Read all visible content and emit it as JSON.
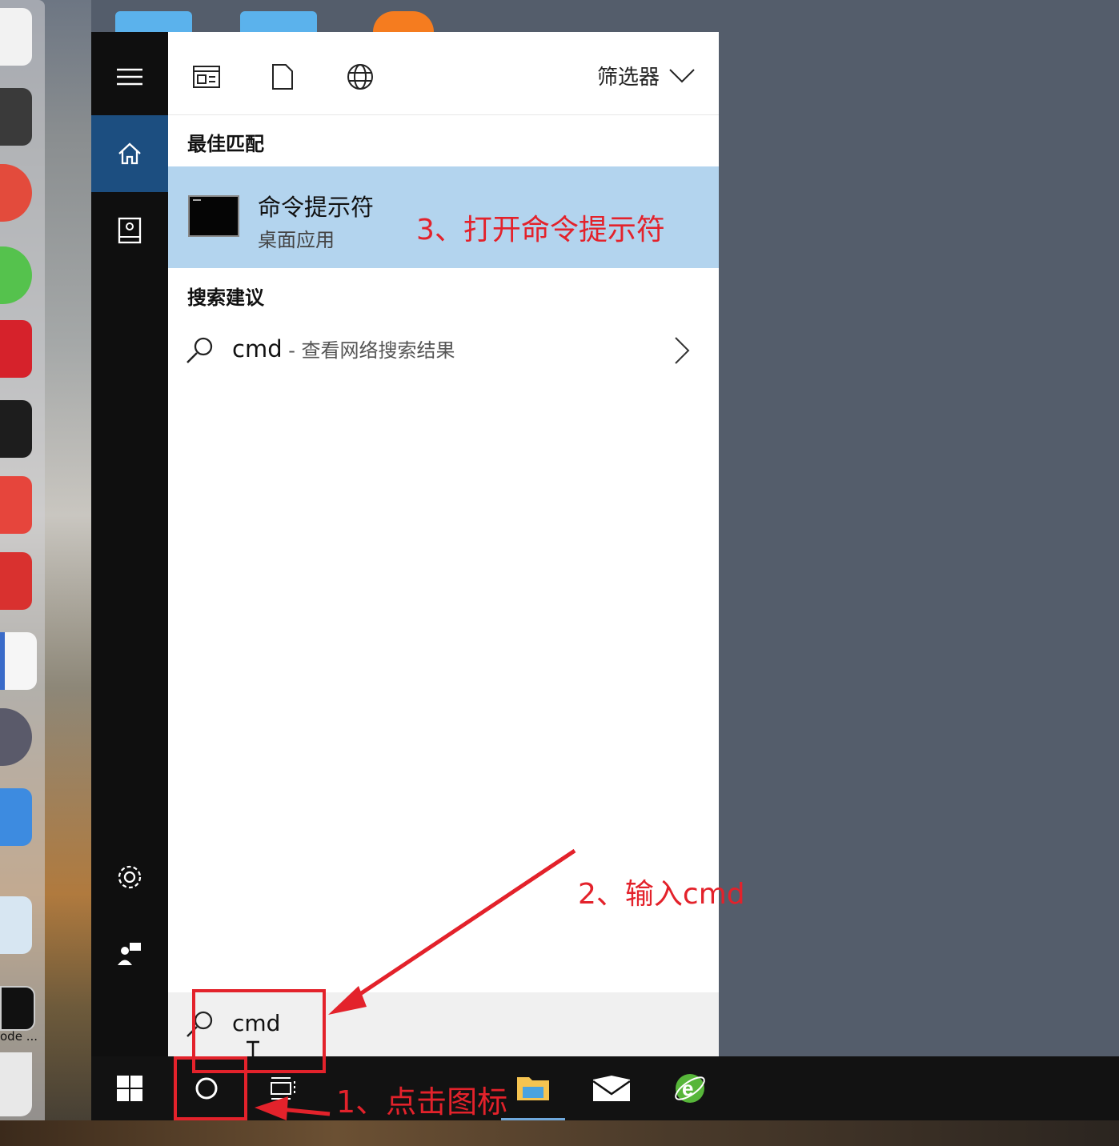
{
  "rail": {
    "items": [
      "menu-icon",
      "home-icon",
      "document-library-icon",
      "settings-icon",
      "user-feedback-icon"
    ]
  },
  "topbar": {
    "icons": [
      "app-window-icon",
      "document-icon",
      "globe-icon"
    ],
    "filter_label": "筛选器"
  },
  "best_match": {
    "heading": "最佳匹配",
    "name": "命令提示符",
    "type": "桌面应用"
  },
  "suggestions": {
    "heading": "搜索建议",
    "query": "cmd",
    "suffix": " - 查看网络搜索结果"
  },
  "search": {
    "value": "cmd"
  },
  "dock": {
    "partial_label": "ode ..."
  },
  "annotations": {
    "step1": "1、点击图标",
    "step2": "2、输入cmd",
    "step3": "3、打开命令提示符"
  },
  "colors": {
    "accent": "#1c4e80",
    "highlight": "#b3d4ee",
    "annotation": "#e3222b"
  }
}
